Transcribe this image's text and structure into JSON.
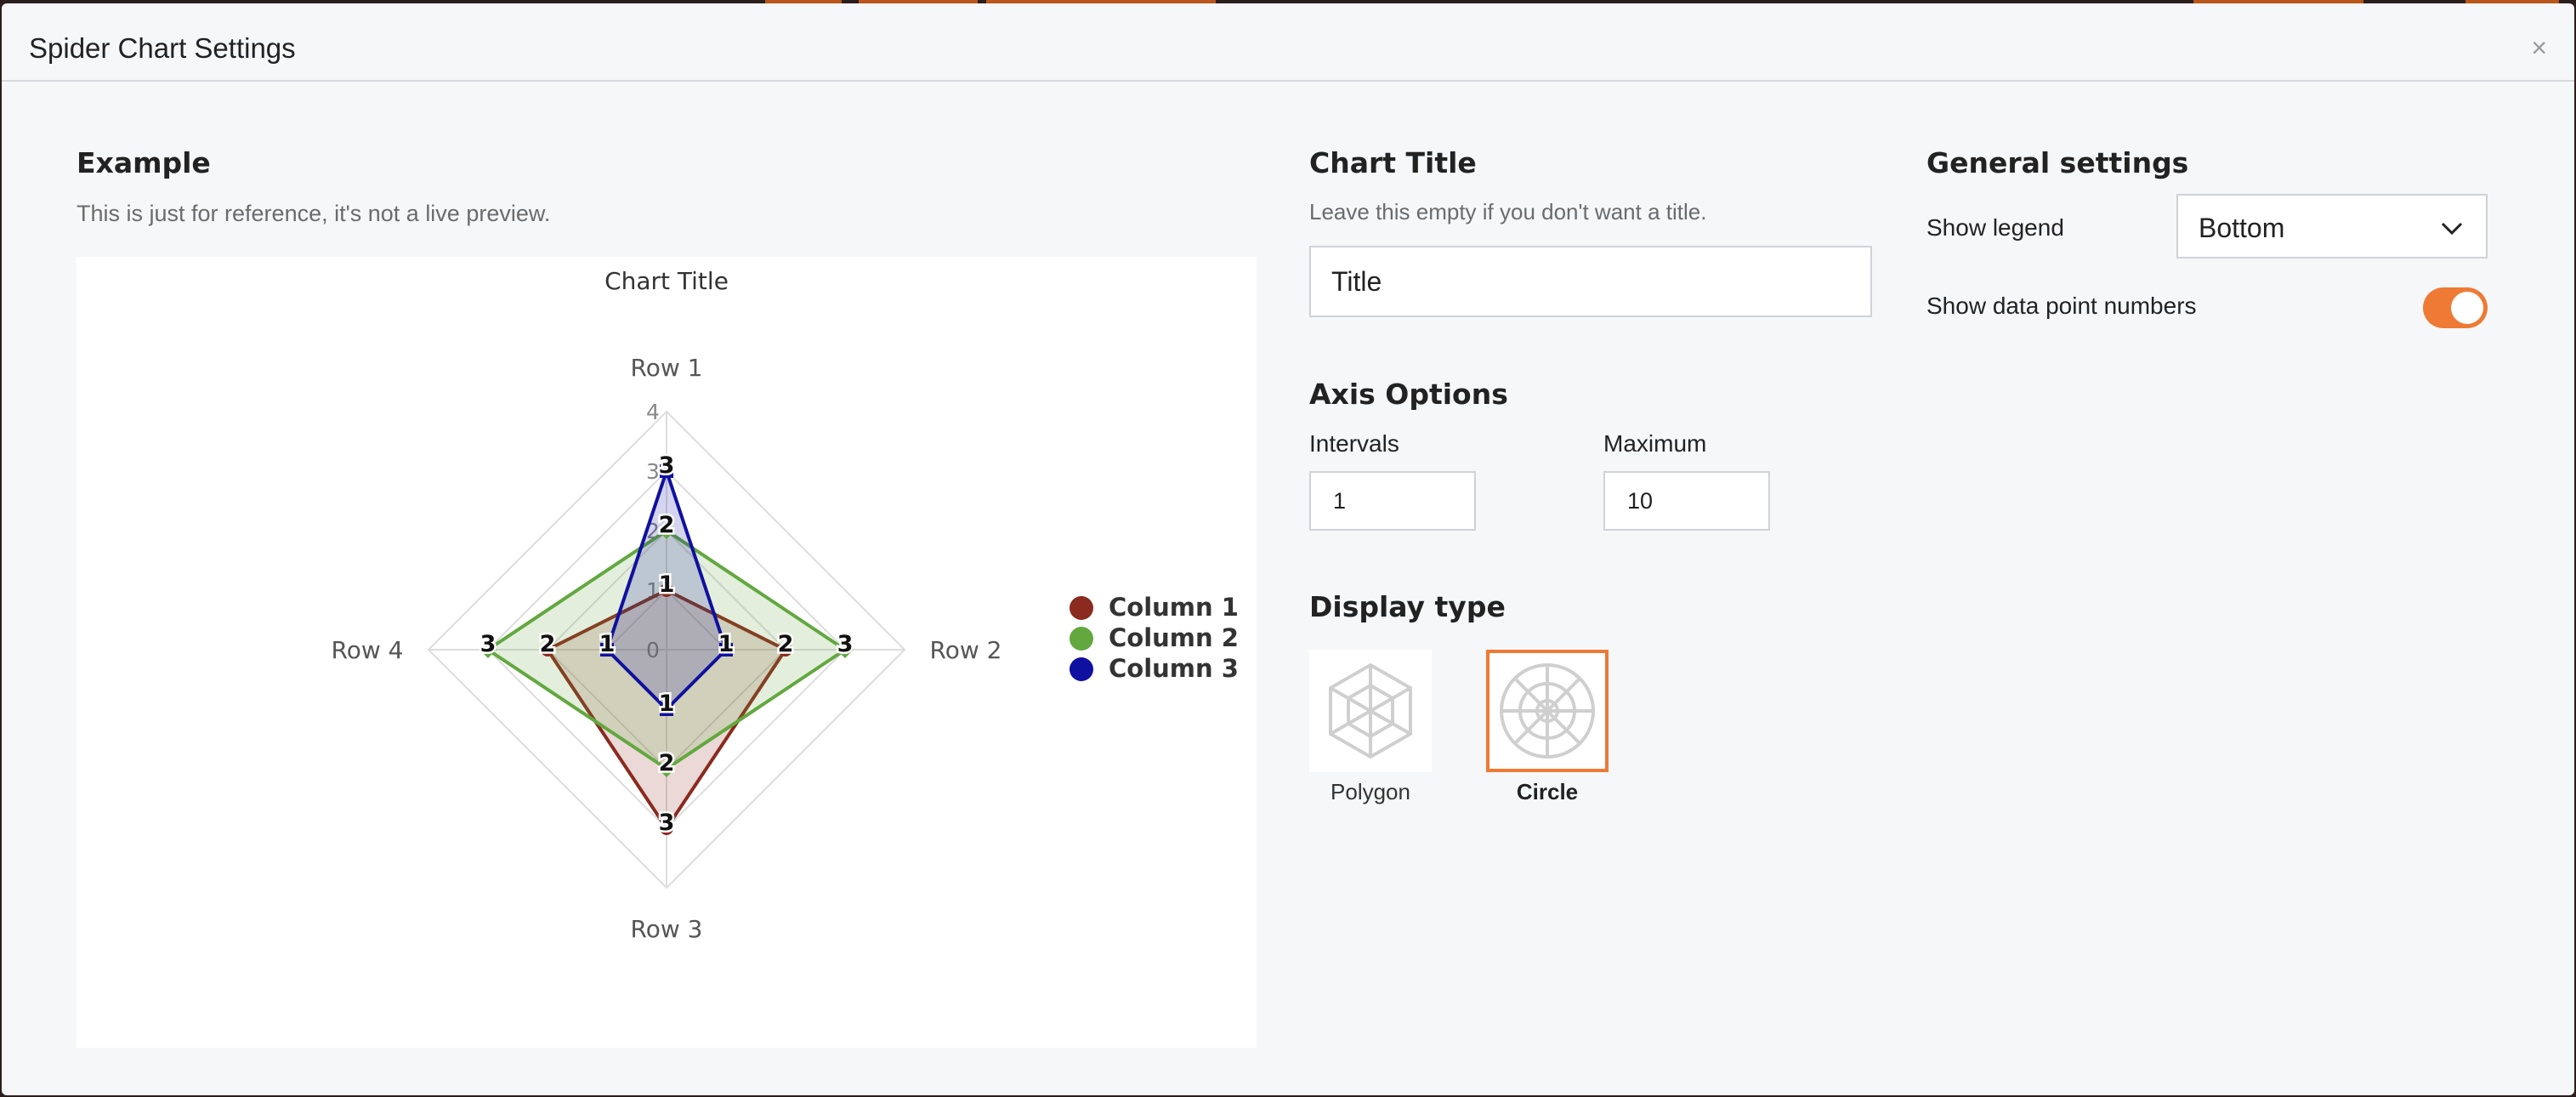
{
  "dialog": {
    "title": "Spider Chart Settings",
    "close_label": "×"
  },
  "example": {
    "heading": "Example",
    "subtext": "This is just for reference, it's not a live preview."
  },
  "chart_title_section": {
    "heading": "Chart Title",
    "subtext": "Leave this empty if you don't want a title.",
    "input_value": "Title"
  },
  "axis_options": {
    "heading": "Axis Options",
    "intervals_label": "Intervals",
    "intervals_value": "1",
    "maximum_label": "Maximum",
    "maximum_value": "10"
  },
  "display_type": {
    "heading": "Display type",
    "options": [
      {
        "label": "Polygon",
        "selected": false,
        "icon": "polygon-web-icon"
      },
      {
        "label": "Circle",
        "selected": true,
        "icon": "circle-web-icon"
      }
    ]
  },
  "general_settings": {
    "heading": "General settings",
    "show_legend_label": "Show legend",
    "show_legend_value": "Bottom",
    "show_numbers_label": "Show data point numbers",
    "show_numbers_on": true
  },
  "colors": {
    "accent": "#ee7a35"
  },
  "chart_data": {
    "type": "radar",
    "title": "Chart Title",
    "categories": [
      "Row 1",
      "Row 2",
      "Row 3",
      "Row 4"
    ],
    "axis_ticks": [
      "0",
      "1",
      "2",
      "3",
      "4"
    ],
    "axis_max": 4,
    "series": [
      {
        "name": "Column 1",
        "values": [
          1,
          2,
          3,
          2
        ],
        "color": "#8b2a1e"
      },
      {
        "name": "Column 2",
        "values": [
          2,
          3,
          2,
          3
        ],
        "color": "#62a83f"
      },
      {
        "name": "Column 3",
        "values": [
          3,
          1,
          1,
          1
        ],
        "color": "#1010a0"
      }
    ],
    "legend_position": "right",
    "show_data_labels": true
  }
}
